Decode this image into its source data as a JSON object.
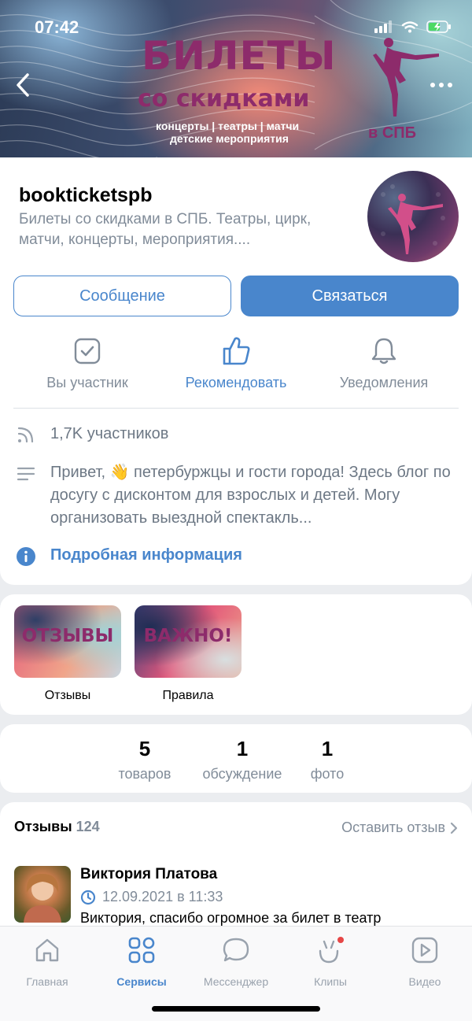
{
  "status_bar": {
    "time": "07:42"
  },
  "cover": {
    "title_line1": "БИЛЕТЫ",
    "title_line2": "со скидками",
    "subtitle_line1": "концерты | театры | матчи",
    "subtitle_line2": "детские мероприятия",
    "city": "в СПБ"
  },
  "group": {
    "name": "bookticketspb",
    "description": "Билеты со скидками в СПБ. Театры, цирк, матчи, концерты, мероприятия...."
  },
  "buttons": {
    "message": "Сообщение",
    "contact": "Связаться"
  },
  "actions": [
    {
      "label": "Вы участник",
      "icon": "checkbox-icon"
    },
    {
      "label": "Рекомендовать",
      "icon": "thumbs-up-icon"
    },
    {
      "label": "Уведомления",
      "icon": "bell-icon"
    }
  ],
  "info": {
    "members": "1,7K участников",
    "description": "Привет, 👋 петербуржцы и гости города! Здесь блог по досугу с дисконтом для взрослых и детей.  Могу организовать выездной спектакль...",
    "more": "Подробная информация"
  },
  "stories": [
    {
      "thumb_text": "ОТЗЫВЫ",
      "caption": "Отзывы"
    },
    {
      "thumb_text": "ВАЖНО!",
      "caption": "Правила"
    }
  ],
  "counters": [
    {
      "num": "5",
      "label": "товаров"
    },
    {
      "num": "1",
      "label": "обсуждение"
    },
    {
      "num": "1",
      "label": "фото"
    }
  ],
  "reviews": {
    "title": "Отзывы",
    "count": "124",
    "leave": "Оставить отзыв",
    "item": {
      "author": "Виктория Платова",
      "date": "12.09.2021 в 11:33",
      "text": "Виктория, спасибо огромное за билет в театр"
    }
  },
  "tabbar": [
    {
      "label": "Главная",
      "icon": "home-icon"
    },
    {
      "label": "Сервисы",
      "icon": "services-icon"
    },
    {
      "label": "Мессенджер",
      "icon": "messenger-icon"
    },
    {
      "label": "Клипы",
      "icon": "clips-icon"
    },
    {
      "label": "Видео",
      "icon": "video-icon"
    }
  ],
  "colors": {
    "accent": "#4986cc",
    "secondary_text": "#818c99",
    "cover_title": "#8d2b6b"
  }
}
